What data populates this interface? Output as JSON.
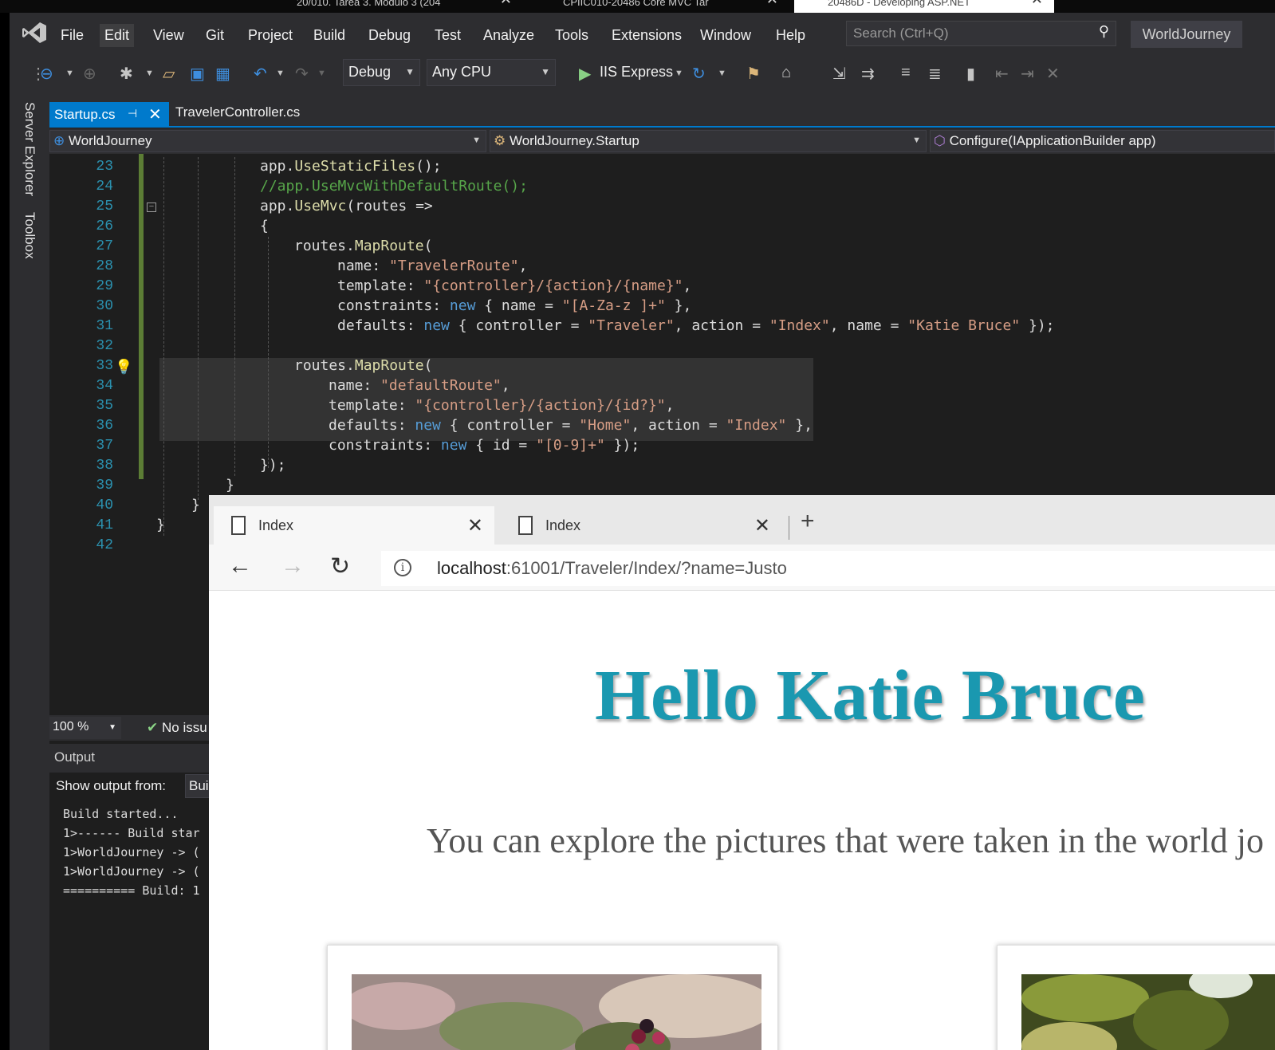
{
  "browser_tabs_top": [
    {
      "label": "20/010. Tarea 3. Módulo 3 (204"
    },
    {
      "label": "CPIIC010-20486 Core MVC Tar"
    },
    {
      "label": "20486D - Developing ASP.NET"
    }
  ],
  "menu": [
    "File",
    "Edit",
    "View",
    "Git",
    "Project",
    "Build",
    "Debug",
    "Test",
    "Analyze",
    "Tools",
    "Extensions",
    "Window",
    "Help"
  ],
  "search": {
    "placeholder": "Search (Ctrl+Q)"
  },
  "solution_name": "WorldJourney",
  "toolbar": {
    "config": "Debug",
    "platform": "Any CPU",
    "run_target": "IIS Express"
  },
  "side_tabs": [
    "Server Explorer",
    "Toolbox"
  ],
  "doc_tabs": [
    {
      "label": "Startup.cs",
      "active": true
    },
    {
      "label": "TravelerController.cs",
      "active": false
    }
  ],
  "nav": {
    "project": "WorldJourney",
    "type": "WorldJourney.Startup",
    "member": "Configure(IApplicationBuilder app)"
  },
  "code_lines": [
    {
      "n": "23",
      "text": "app.UseStaticFiles();"
    },
    {
      "n": "24",
      "text": "//app.UseMvcWithDefaultRoute();"
    },
    {
      "n": "25",
      "text": "app.UseMvc(routes =>"
    },
    {
      "n": "26",
      "text": "{"
    },
    {
      "n": "27",
      "text": "routes.MapRoute("
    },
    {
      "n": "28",
      "text": "name: \"TravelerRoute\","
    },
    {
      "n": "29",
      "text": "template: \"{controller}/{action}/{name}\","
    },
    {
      "n": "30",
      "text": "constraints: new { name = \"[A-Za-z ]+\" },"
    },
    {
      "n": "31",
      "text": "defaults: new { controller = \"Traveler\", action = \"Index\", name = \"Katie Bruce\" });"
    },
    {
      "n": "32",
      "text": ""
    },
    {
      "n": "33",
      "text": "routes.MapRoute("
    },
    {
      "n": "34",
      "text": "name: \"defaultRoute\","
    },
    {
      "n": "35",
      "text": "template: \"{controller}/{action}/{id?}\","
    },
    {
      "n": "36",
      "text": "defaults: new { controller = \"Home\", action = \"Index\" },"
    },
    {
      "n": "37",
      "text": "constraints: new { id = \"[0-9]+\" });"
    },
    {
      "n": "38",
      "text": "});"
    },
    {
      "n": "39",
      "text": "}"
    },
    {
      "n": "40",
      "text": "}"
    },
    {
      "n": "41",
      "text": "}"
    },
    {
      "n": "42",
      "text": ""
    }
  ],
  "editor_status": {
    "zoom": "100 %",
    "issues": "No issu"
  },
  "output": {
    "title": "Output",
    "show_from_label": "Show output from:",
    "source": "Bui",
    "lines": [
      "Build started...",
      "1>------ Build star",
      "1>WorldJourney -> (",
      "1>WorldJourney -> (",
      "========== Build: 1"
    ]
  },
  "browser": {
    "tabs": [
      {
        "label": "Index"
      },
      {
        "label": "Index"
      }
    ],
    "url_host": "localhost",
    "url_rest": ":61001/Traveler/Index/?name=Justo",
    "heading": "Hello Katie Bruce",
    "subtitle": "You can explore the pictures that were taken in the world jo"
  },
  "colors": {
    "vs_accent": "#007acc",
    "heading": "#1a98b0",
    "keyword": "#569cd6",
    "string": "#d69d85",
    "comment": "#57a64a",
    "method": "#dcdcaa"
  }
}
